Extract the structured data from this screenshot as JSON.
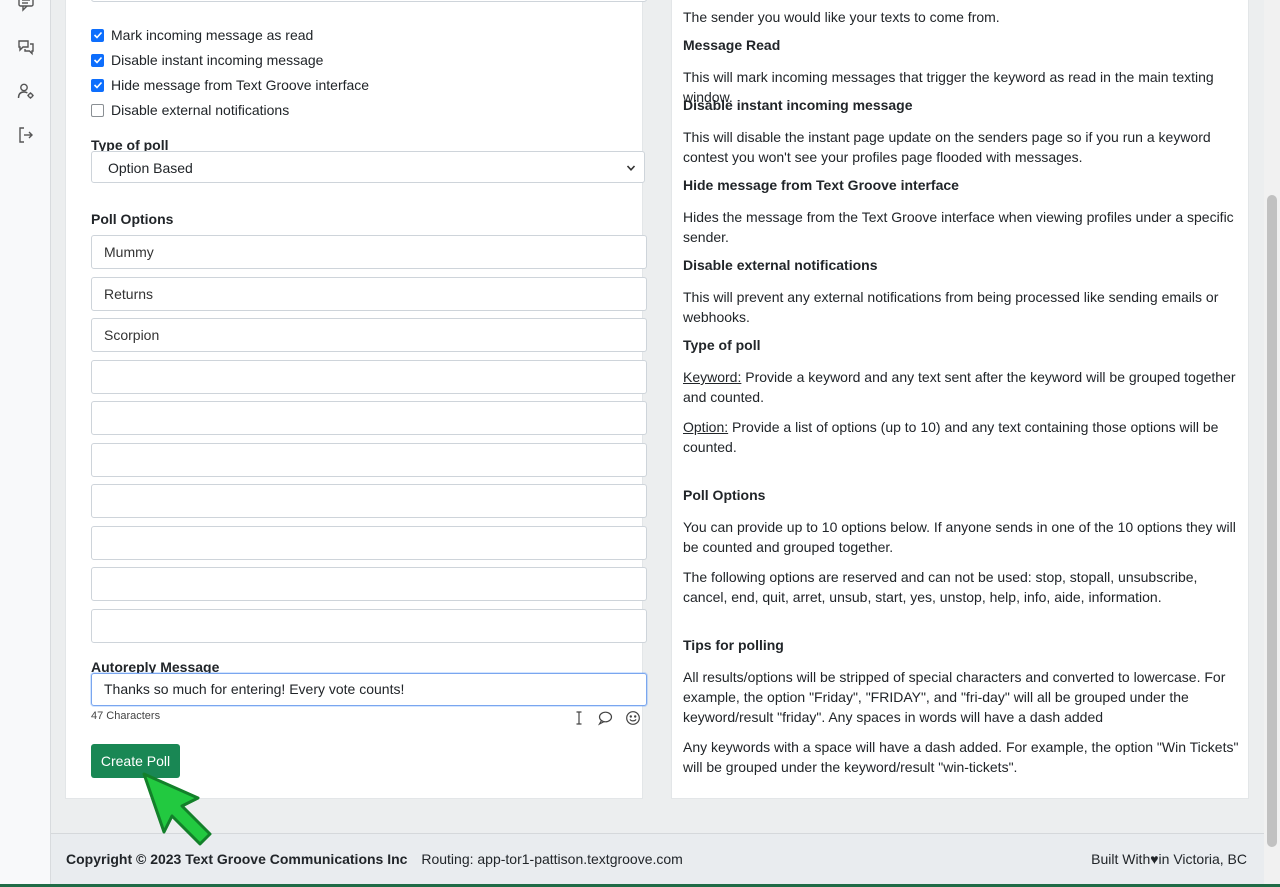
{
  "sidebar": {
    "icons": [
      "message-square-icon",
      "chat-bubbles-icon",
      "user-settings-icon",
      "logout-icon"
    ]
  },
  "form": {
    "checkboxes": [
      {
        "label": "Mark incoming message as read",
        "checked": true
      },
      {
        "label": "Disable instant incoming message",
        "checked": true
      },
      {
        "label": "Hide message from Text Groove interface",
        "checked": true
      },
      {
        "label": "Disable external notifications",
        "checked": false
      }
    ],
    "type_of_poll_label": "Type of poll",
    "type_of_poll_value": "Option Based",
    "poll_options_label": "Poll Options",
    "poll_options": [
      "Mummy",
      "Returns",
      "Scorpion",
      "",
      "",
      "",
      "",
      "",
      "",
      ""
    ],
    "autoreply_label": "Autoreply Message",
    "autoreply_value": "Thanks so much for entering! Every vote counts!",
    "char_count": "47 Characters",
    "create_button": "Create Poll"
  },
  "help": {
    "sender_text": "The sender you would like your texts to come from.",
    "message_read_head": "Message Read",
    "message_read_text": "This will mark incoming messages that trigger the keyword as read in the main texting window.",
    "disable_instant_head": "Disable instant incoming message",
    "disable_instant_text": "This will disable the instant page update on the senders page so if you run a keyword contest you won't see your profiles page flooded with messages.",
    "hide_message_head": "Hide message from Text Groove interface",
    "hide_message_text": "Hides the message from the Text Groove interface when viewing profiles under a specific sender.",
    "disable_external_head": "Disable external notifications",
    "disable_external_text": "This will prevent any external notifications from being processed like sending emails or webhooks.",
    "type_of_poll_head": "Type of poll",
    "keyword_label": "Keyword:",
    "keyword_text": " Provide a keyword and any text sent after the keyword will be grouped together and counted.",
    "option_label": "Option:",
    "option_text": " Provide a list of options (up to 10) and any text containing those options will be counted.",
    "poll_options_head": "Poll Options",
    "poll_options_text1": "You can provide up to 10 options below. If anyone sends in one of the 10 options they will be counted and grouped together.",
    "poll_options_text2": "The following options are reserved and can not be used: stop, stopall, unsubscribe, cancel, end, quit, arret, unsub, start, yes, unstop, help, info, aide, information.",
    "tips_head": "Tips for polling",
    "tips_text1": "All results/options will be stripped of special characters and converted to lowercase. For example, the option \"Friday\", \"FRIDAY\", and \"fri-day\" will all be grouped under the keyword/result \"friday\". Any spaces in words will have a dash added",
    "tips_text2": "Any keywords with a space will have a dash added. For example, the option \"Win Tickets\" will be grouped under the keyword/result \"win-tickets\"."
  },
  "footer": {
    "copyright": "Copyright © 2023 Text Groove Communications Inc",
    "routing": "Routing: app-tor1-pattison.textgroove.com",
    "built_with_prefix": "Built With",
    "heart": "♥",
    "built_with_suffix": "in Victoria, BC"
  },
  "colors": {
    "accent": "#198754",
    "checkbox": "#0d6efd"
  }
}
